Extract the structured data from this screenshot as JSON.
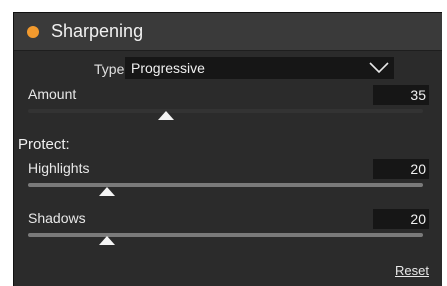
{
  "panel": {
    "title": "Sharpening",
    "accent_color": "#f29a2e"
  },
  "type": {
    "label": "Type",
    "value": "Progressive",
    "icon": "chevron-down-icon"
  },
  "amount": {
    "label": "Amount",
    "value": "35",
    "level": 0.35,
    "track_color": "#333333"
  },
  "protect": {
    "label": "Protect:"
  },
  "highlights": {
    "label": "Highlights",
    "value": "20",
    "level": 0.2,
    "track_color": "#7a7a7a"
  },
  "shadows": {
    "label": "Shadows",
    "value": "20",
    "level": 0.2,
    "track_color": "#7a7a7a"
  },
  "reset": {
    "label": "Reset"
  }
}
